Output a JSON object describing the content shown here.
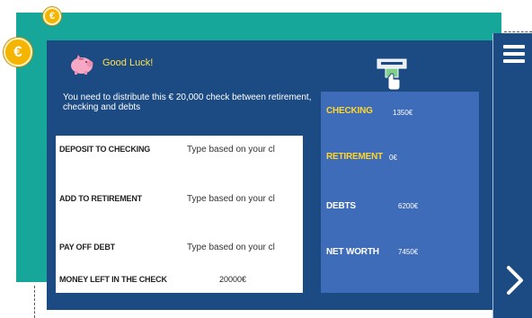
{
  "header": {
    "greeting": "Good Luck!"
  },
  "instruction": "You need to distribute this € 20,000 check between retirement, checking and debts",
  "form": {
    "deposit_label": "DEPOSIT TO CHECKING",
    "deposit_placeholder": "Type based on your cl",
    "retirement_label": "ADD TO RETIREMENT",
    "retirement_placeholder": "Type based on your cl",
    "debt_label": "PAY OFF DEBT",
    "debt_placeholder": "Type based on your cl",
    "money_left_label": "MONEY LEFT IN THE CHECK",
    "money_left_value": "20000€"
  },
  "stats": {
    "checking_label": "CHECKING",
    "checking_value": "1350€",
    "retirement_label": "RETIREMENT",
    "retirement_value": "0€",
    "debts_label": "DEBTS",
    "debts_value": "6200€",
    "net_worth_label": "NET WORTH",
    "net_worth_value": "7450€"
  },
  "coin_symbol": "€",
  "icons": {
    "menu": "hamburger-menu-icon",
    "next": "chevron-right-icon",
    "piggy": "piggy-bank-icon",
    "atm": "atm-cash-icon",
    "coin": "euro-coin-icon"
  },
  "colors": {
    "panel": "#1c4b84",
    "teal_card": "#16a79a",
    "stats_box": "#3f6cb8",
    "highlight_yellow": "#ffd62a"
  }
}
